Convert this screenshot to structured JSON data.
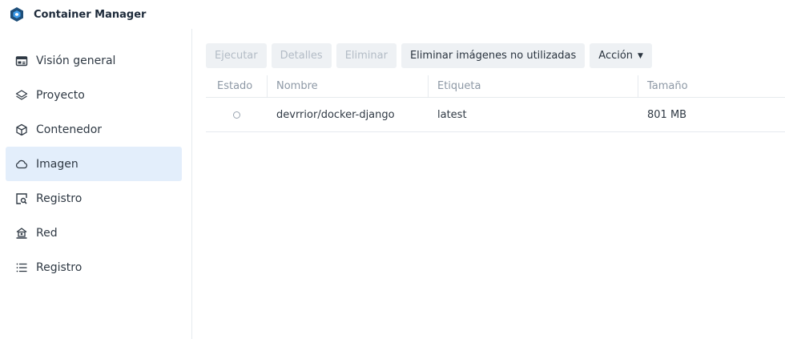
{
  "app": {
    "title": "Container Manager",
    "logo_icon": "container-manager-logo-icon",
    "accent": "#1e4f7a"
  },
  "sidebar": {
    "items": [
      {
        "label": "Visión general",
        "icon": "overview-icon",
        "active": false
      },
      {
        "label": "Proyecto",
        "icon": "project-layers-icon",
        "active": false
      },
      {
        "label": "Contenedor",
        "icon": "container-box-icon",
        "active": false
      },
      {
        "label": "Imagen",
        "icon": "cloud-icon",
        "active": true
      },
      {
        "label": "Registro",
        "icon": "registry-search-icon",
        "active": false
      },
      {
        "label": "Red",
        "icon": "network-icon",
        "active": false
      },
      {
        "label": "Registro",
        "icon": "log-list-icon",
        "active": false
      }
    ],
    "active_color": "#e3eefb"
  },
  "toolbar": {
    "run_label": "Ejecutar",
    "details_label": "Detalles",
    "delete_label": "Eliminar",
    "prune_label": "Eliminar imágenes no utilizadas",
    "action_label": "Acción"
  },
  "table": {
    "columns": [
      "Estado",
      "Nombre",
      "Etiqueta",
      "Tamaño"
    ],
    "rows": [
      {
        "status": "stopped",
        "name": "devrrior/docker-django",
        "tag": "latest",
        "size": "801 MB"
      }
    ]
  }
}
